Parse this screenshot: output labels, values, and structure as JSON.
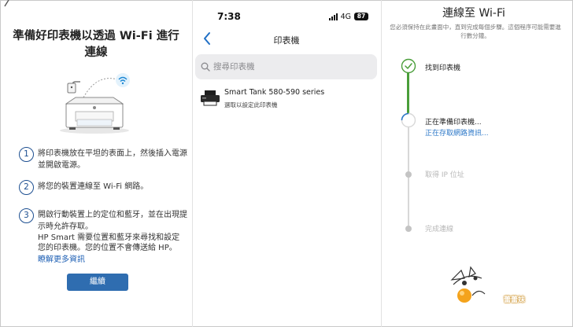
{
  "setup": {
    "title": "準備好印表機以透過 Wi-Fi 進行連線",
    "steps": [
      {
        "num": "1",
        "text": "將印表機放在平坦的表面上，然後插入電源並開啟電源。"
      },
      {
        "num": "2",
        "text": "將您的裝置連線至 Wi-Fi 網路。"
      },
      {
        "num": "3",
        "text": "開啟行動裝置上的定位和藍牙，並在出現提示時允許存取。"
      }
    ],
    "note": "HP Smart 需要位置和藍牙來尋找和設定您的印表機。您的位置不會傳送給 HP。",
    "learn_more": "瞭解更多資訊",
    "continue_label": "繼續",
    "accent": "#2f6db0"
  },
  "printer_list": {
    "status_bar": {
      "time": "7:38",
      "network": "4G",
      "battery": "87"
    },
    "title": "印表機",
    "search_placeholder": "搜尋印表機",
    "printers": [
      {
        "name": "Smart Tank 580-590 series",
        "subtitle": "選取以設定此印表機"
      }
    ]
  },
  "connection": {
    "title": "連線至 Wi-Fi",
    "subtitle": "您必須保持在此畫面中，直到完成每個步驟。這個程序可能需要進行數分鐘。",
    "stages": [
      {
        "label": "找到印表機",
        "detail": "",
        "state": "done"
      },
      {
        "label": "正在準備印表機...",
        "detail": "正在存取網路資訊...",
        "state": "active"
      },
      {
        "label": "取得 IP 位址",
        "detail": "",
        "state": "pending"
      },
      {
        "label": "完成連線",
        "detail": "",
        "state": "pending"
      }
    ],
    "colors": {
      "done": "#4a9e3a",
      "active": "#2d78c8",
      "pending": "#c4c4c4"
    },
    "watermark": "蕾蕾妹"
  }
}
